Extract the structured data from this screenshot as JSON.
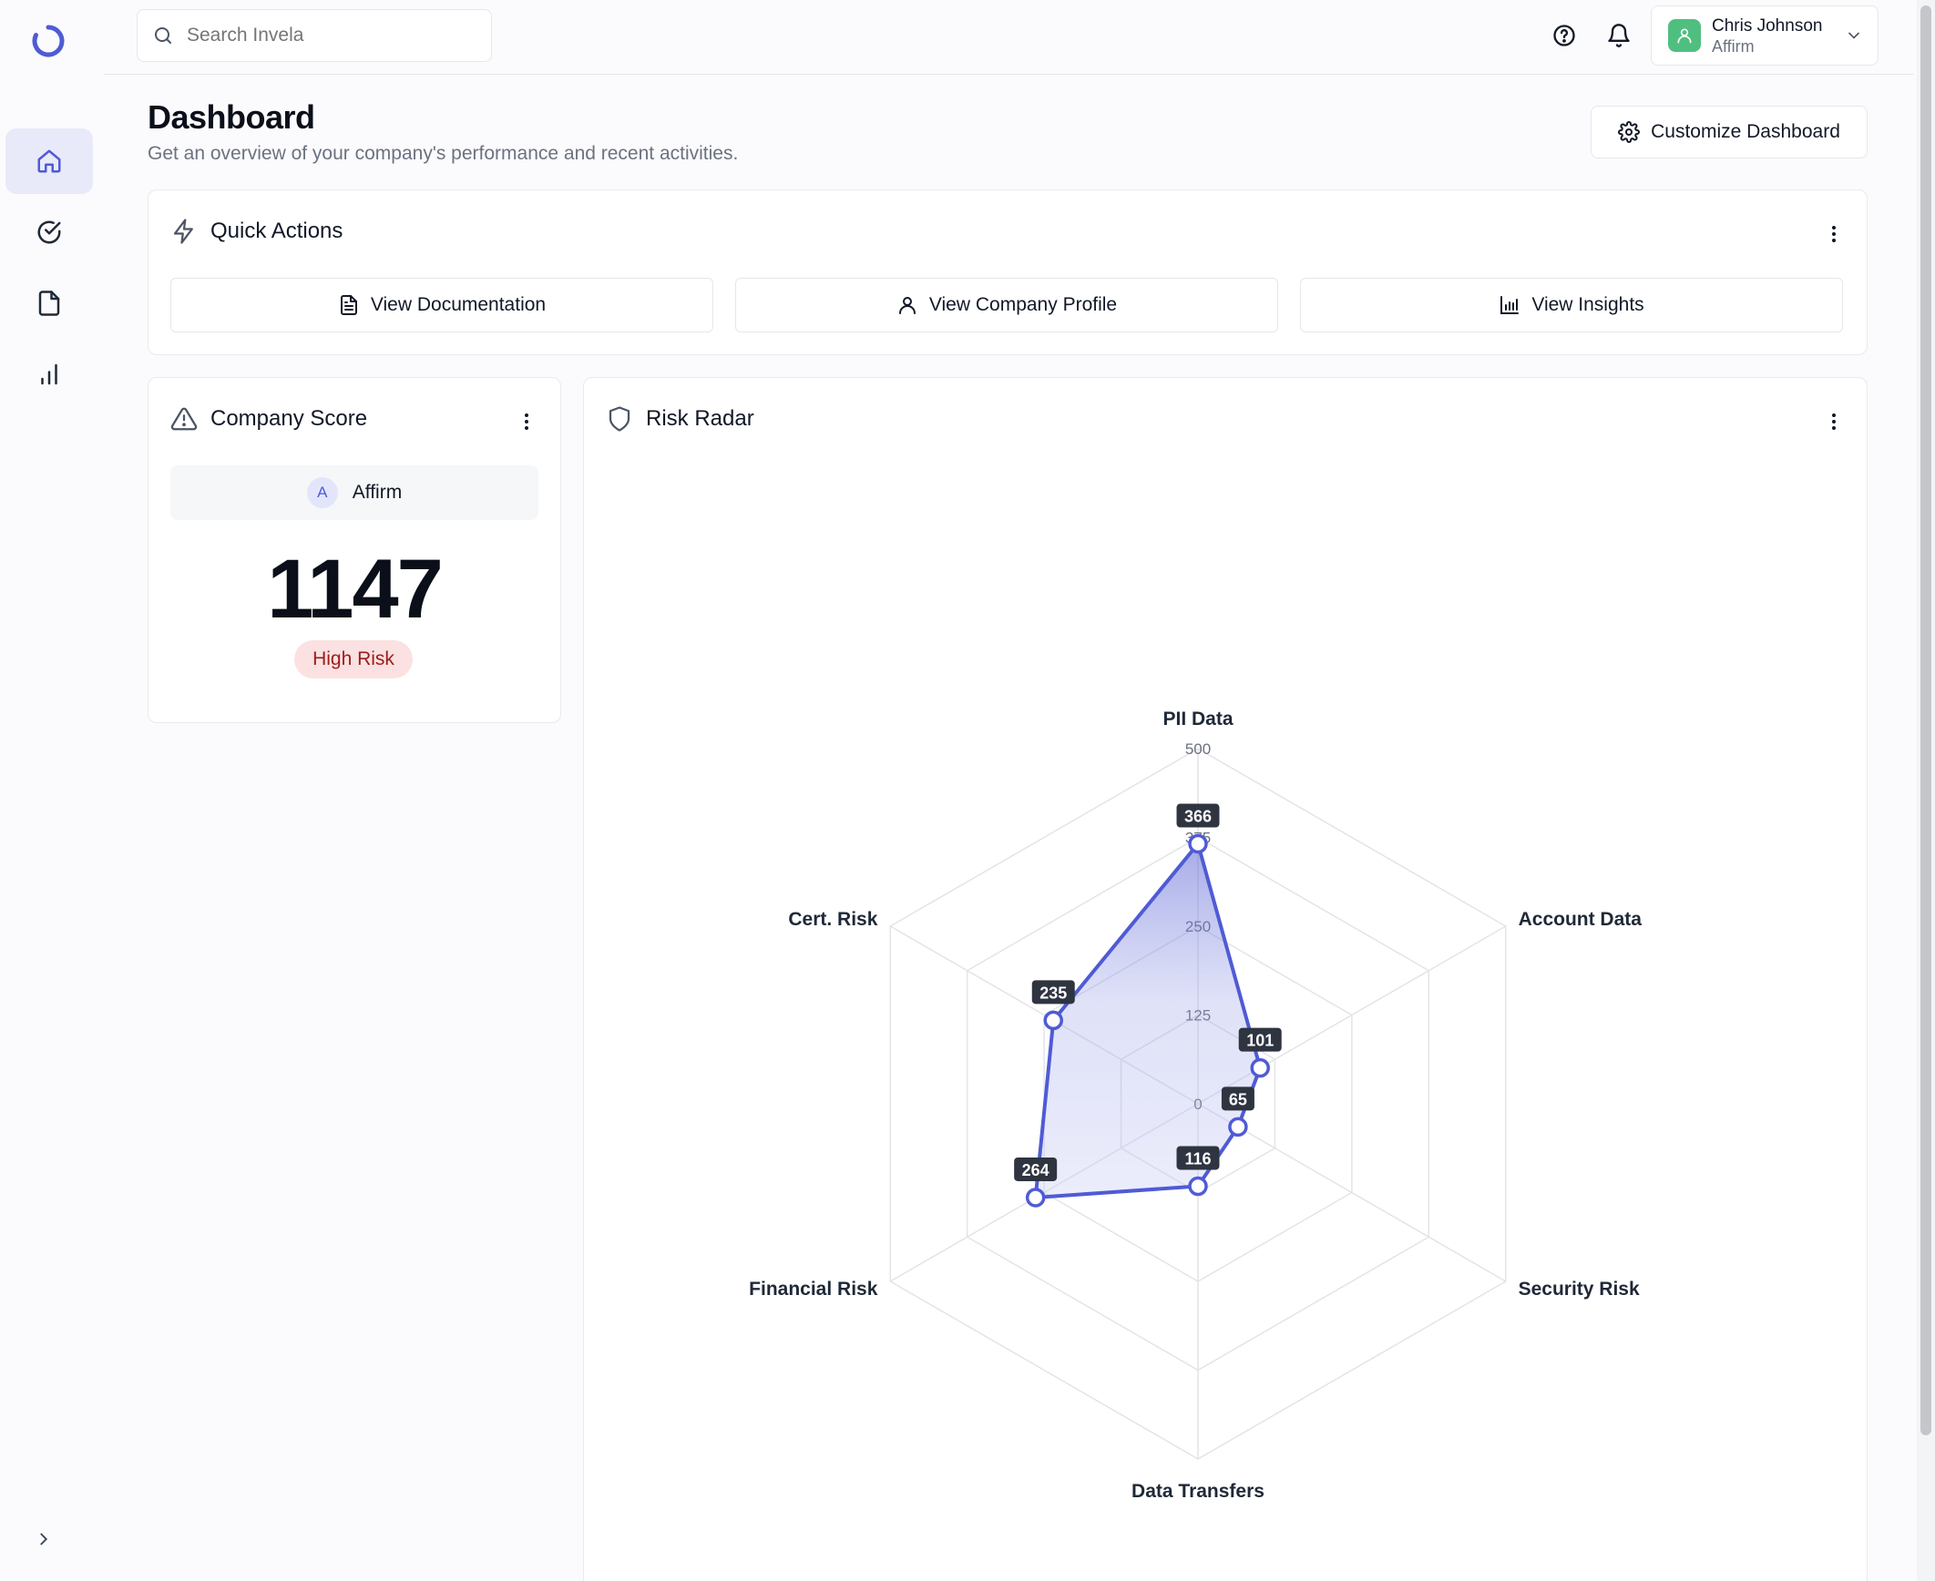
{
  "topbar": {
    "search_placeholder": "Search Invela",
    "user_name": "Chris Johnson",
    "user_company": "Affirm"
  },
  "header": {
    "title": "Dashboard",
    "subtitle": "Get an overview of your company's performance and recent activities.",
    "customize_label": "Customize Dashboard"
  },
  "quick_actions": {
    "title": "Quick Actions",
    "buttons": [
      {
        "label": "View Documentation",
        "icon": "document-icon"
      },
      {
        "label": "View Company Profile",
        "icon": "user-icon"
      },
      {
        "label": "View Insights",
        "icon": "chart-icon"
      }
    ]
  },
  "company_score": {
    "title": "Company Score",
    "company_initial": "A",
    "company_name": "Affirm",
    "score": "1147",
    "risk_label": "High Risk"
  },
  "risk_radar": {
    "title": "Risk Radar"
  },
  "colors": {
    "accent": "#4f5bd5",
    "risk_badge_bg": "#fbe1e1",
    "risk_badge_text": "#9b1c1c",
    "avatar": "#4fbf7f"
  },
  "chart_data": {
    "type": "radar",
    "categories": [
      "PII Data",
      "Account Data",
      "Security Risk",
      "Data Transfers",
      "Financial Risk",
      "Cert. Risk"
    ],
    "values": [
      366,
      101,
      65,
      116,
      264,
      235
    ],
    "ticks": [
      0,
      125,
      250,
      375,
      500
    ],
    "range": [
      0,
      500
    ]
  }
}
